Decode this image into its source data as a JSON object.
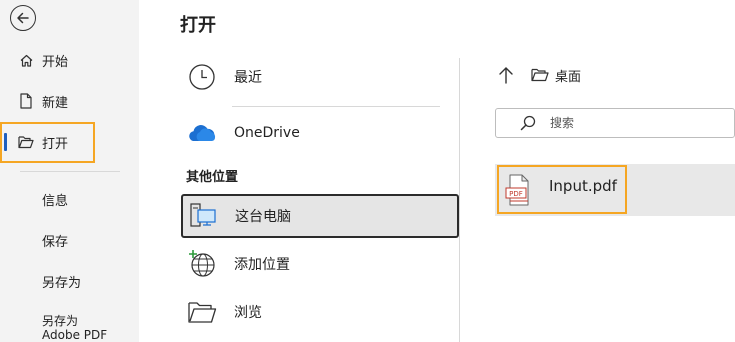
{
  "sidebar": {
    "items": [
      {
        "label": "开始",
        "icon": "home-icon"
      },
      {
        "label": "新建",
        "icon": "new-document-icon"
      },
      {
        "label": "打开",
        "icon": "open-folder-icon",
        "active": true
      },
      {
        "label": "信息"
      },
      {
        "label": "保存"
      },
      {
        "label": "另存为"
      },
      {
        "label": "另存为\nAdobe PDF"
      }
    ]
  },
  "main": {
    "title": "打开",
    "locations": [
      {
        "label": "最近",
        "icon": "clock-icon"
      },
      {
        "label": "OneDrive",
        "icon": "onedrive-cloud-icon"
      }
    ],
    "other_section_label": "其他位置",
    "other_locations": [
      {
        "label": "这台电脑",
        "icon": "this-pc-icon",
        "selected": true
      },
      {
        "label": "添加位置",
        "icon": "add-location-icon"
      },
      {
        "label": "浏览",
        "icon": "browse-folder-icon"
      }
    ]
  },
  "browser": {
    "current_folder": "桌面",
    "search_placeholder": "搜索",
    "files": [
      {
        "name": "Input.pdf",
        "icon": "pdf-file-icon",
        "icon_text": "PDF"
      }
    ]
  },
  "colors": {
    "accent": "#1f5fbf",
    "highlight": "#f5a623",
    "sidebar_bg": "#f3f3f3",
    "selected_bg": "#e5e5e5"
  }
}
